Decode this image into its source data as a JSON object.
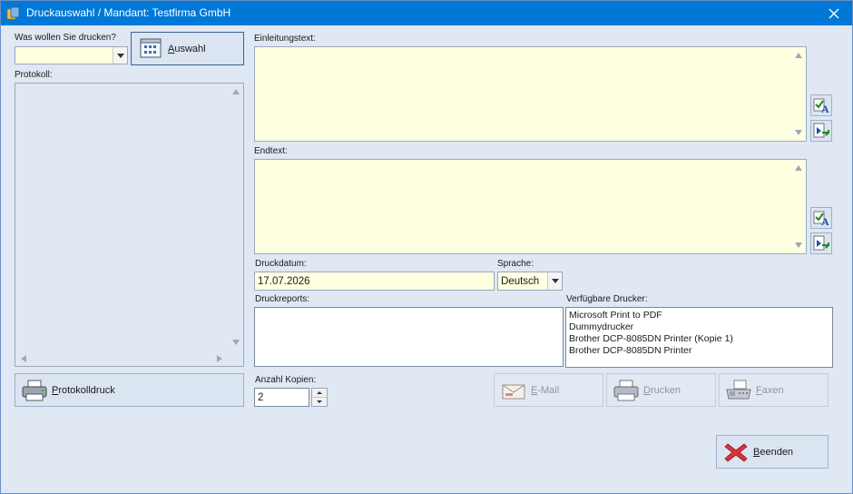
{
  "window": {
    "title": "Druckauswahl / Mandant: Testfirma GmbH"
  },
  "left": {
    "print_what_label": "Was wollen Sie drucken?",
    "print_what_value": "",
    "auswahl_button": "Auswahl",
    "protokoll_label": "Protokoll:",
    "protokolldruck_button": "Protokolldruck"
  },
  "right": {
    "einleitung_label": "Einleitungstext:",
    "einleitung_value": "",
    "endtext_label": "Endtext:",
    "endtext_value": "",
    "druckdatum_label": "Druckdatum:",
    "druckdatum_value": "17.07.2026",
    "sprache_label": "Sprache:",
    "sprache_value": "Deutsch",
    "druckreports_label": "Druckreports:",
    "drucker_label": "Verfügbare Drucker:",
    "printers": [
      "Microsoft Print to PDF",
      "Dummydrucker",
      "Brother DCP-8085DN Printer (Kopie 1)",
      "Brother DCP-8085DN Printer"
    ],
    "kopien_label": "Anzahl Kopien:",
    "kopien_value": "2",
    "email_button": "E-Mail",
    "drucken_button": "Drucken",
    "faxen_button": "Faxen",
    "beenden_button": "Beenden"
  },
  "colors": {
    "titlebar": "#0078d7",
    "window_bg": "#dfe8f3",
    "field_yellow": "#ffffe1",
    "cancel_red": "#d9343a"
  },
  "icons": [
    "app-icon",
    "close-icon",
    "print-selection-icon",
    "printer-icon",
    "email-icon",
    "fax-icon",
    "cancel-icon",
    "text-edit-icon",
    "insert-icon"
  ]
}
